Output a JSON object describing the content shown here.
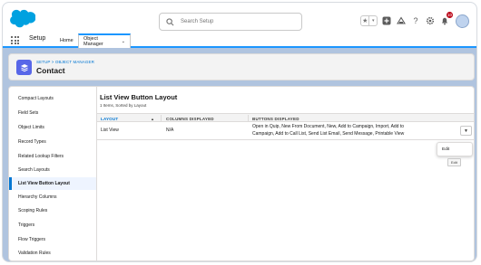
{
  "header": {
    "search_placeholder": "Search Setup",
    "notification_count": "10"
  },
  "context_bar": {
    "app_name": "Setup",
    "tabs": [
      {
        "label": "Home"
      },
      {
        "label": "Object Manager",
        "active": true
      }
    ]
  },
  "object_header": {
    "breadcrumb": "SETUP > OBJECT MANAGER",
    "title": "Contact"
  },
  "sidebar": {
    "items": [
      {
        "label": "Compact Layouts"
      },
      {
        "label": "Field Sets"
      },
      {
        "label": "Object Limits"
      },
      {
        "label": "Record Types"
      },
      {
        "label": "Related Lookup Filters"
      },
      {
        "label": "Search Layouts"
      },
      {
        "label": "List View Button Layout",
        "active": true
      },
      {
        "label": "Hierarchy Columns"
      },
      {
        "label": "Scoping Rules"
      },
      {
        "label": "Triggers"
      },
      {
        "label": "Flow Triggers"
      },
      {
        "label": "Validation Rules"
      }
    ]
  },
  "main": {
    "title": "List View Button Layout",
    "subtitle": "1 Items, Sorted by Layout",
    "columns": [
      "LAYOUT",
      "COLUMNS DISPLAYED",
      "BUTTONS DISPLAYED"
    ],
    "rows": [
      {
        "layout": "List View",
        "columns_displayed": "N/A",
        "buttons_line1": "Open in Quip, New From Document, New, Add to Campaign, Import, Add to",
        "buttons_line2": "Campaign, Add to Call List, Send List Email, Send Message, Printable View"
      }
    ],
    "row_menu": {
      "item": "Edit",
      "tooltip": "Edit"
    }
  },
  "colors": {
    "brand_blue": "#0176d3",
    "object_icon": "#5867e8",
    "page_background": "#b0c4df"
  }
}
